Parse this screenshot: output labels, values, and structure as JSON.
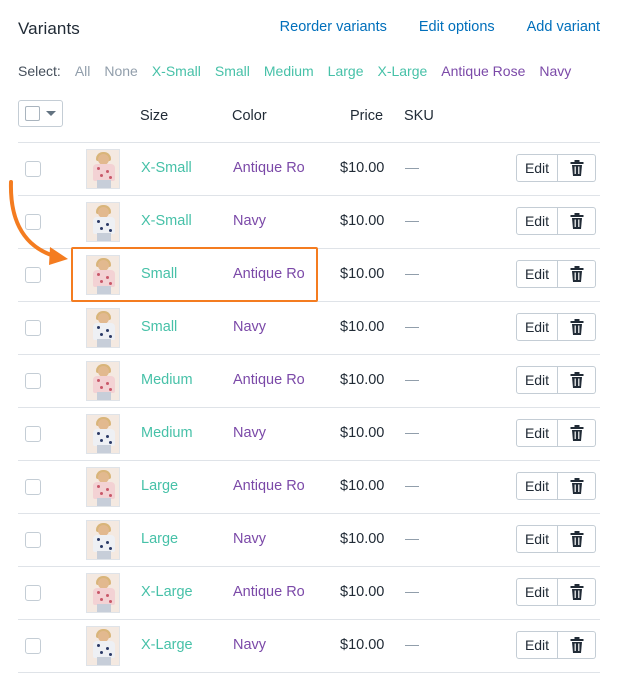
{
  "header": {
    "title": "Variants",
    "actions": [
      "Reorder variants",
      "Edit options",
      "Add variant"
    ]
  },
  "select": {
    "label": "Select:",
    "options": [
      "All",
      "None",
      "X-Small",
      "Small",
      "Medium",
      "Large",
      "X-Large",
      "Antique Rose",
      "Navy"
    ]
  },
  "table": {
    "columns": [
      "Size",
      "Color",
      "Price",
      "SKU"
    ],
    "rows": [
      {
        "size": "X-Small",
        "color": "Antique Ro",
        "price": "$10.00",
        "edit": "Edit"
      },
      {
        "size": "X-Small",
        "color": "Navy",
        "price": "$10.00",
        "edit": "Edit"
      },
      {
        "size": "Small",
        "color": "Antique Ro",
        "price": "$10.00",
        "edit": "Edit"
      },
      {
        "size": "Small",
        "color": "Navy",
        "price": "$10.00",
        "edit": "Edit"
      },
      {
        "size": "Medium",
        "color": "Antique Ro",
        "price": "$10.00",
        "edit": "Edit"
      },
      {
        "size": "Medium",
        "color": "Navy",
        "price": "$10.00",
        "edit": "Edit"
      },
      {
        "size": "Large",
        "color": "Antique Ro",
        "price": "$10.00",
        "edit": "Edit"
      },
      {
        "size": "Large",
        "color": "Navy",
        "price": "$10.00",
        "edit": "Edit"
      },
      {
        "size": "X-Large",
        "color": "Antique Ro",
        "price": "$10.00",
        "edit": "Edit"
      },
      {
        "size": "X-Large",
        "color": "Navy",
        "price": "$10.00",
        "edit": "Edit"
      }
    ]
  },
  "icons": {
    "delete": "trash-icon",
    "thumbnail": "product-image",
    "annotation": "curved-arrow-icon",
    "dropdown": "caret-down-icon"
  },
  "colors": {
    "link": "#006fbb",
    "size": "#47c1a8",
    "color_value": "#7b49a8",
    "annotation": "#f47c20"
  }
}
